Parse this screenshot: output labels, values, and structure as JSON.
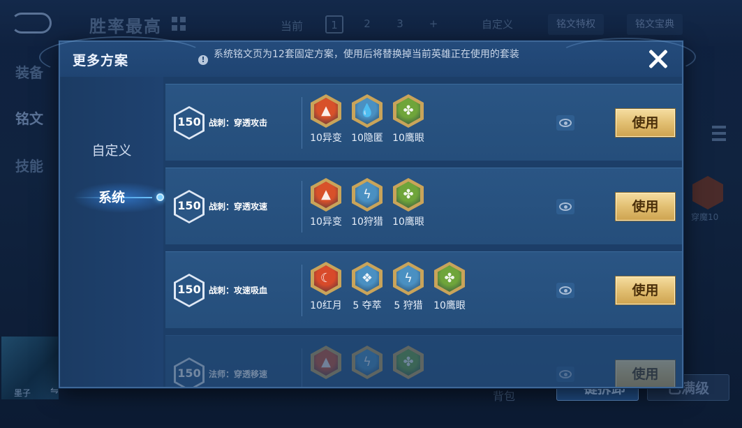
{
  "background": {
    "title": "胜率最高",
    "current_label": "当前",
    "pages": [
      "1",
      "2",
      "3",
      "+"
    ],
    "custom_label": "自定义",
    "buttons": [
      "铭文特权",
      "铭文宝典"
    ],
    "side_tabs": [
      "装备",
      "铭文",
      "技能"
    ],
    "rune_label": "穿魔10",
    "hero_name": "墨子",
    "swap_icon": "⇋",
    "bag_label": "背包",
    "bottom_buttons": [
      "一键拆卸",
      "已满级"
    ]
  },
  "modal": {
    "title": "更多方案",
    "notice": "系统铭文页为12套固定方案，使用后将替换掉当前英雄正在使用的套装",
    "tabs": [
      {
        "label": "自定义",
        "active": false
      },
      {
        "label": "系统",
        "active": true
      }
    ],
    "use_label": "使用",
    "schemes": [
      {
        "level": "150",
        "name": "战刺：穿透攻击",
        "runes": [
          {
            "label": "10异变",
            "icon": "red-arrow-icon",
            "color": "#d8512a"
          },
          {
            "label": "10隐匿",
            "icon": "blue-drop-icon",
            "color": "#4a90c2"
          },
          {
            "label": "10鹰眼",
            "icon": "green-clover-icon",
            "color": "#6fa53a"
          }
        ]
      },
      {
        "level": "150",
        "name": "战刺：穿透攻速",
        "runes": [
          {
            "label": "10异变",
            "icon": "red-arrow-icon",
            "color": "#d8512a"
          },
          {
            "label": "10狩猎",
            "icon": "blue-lightning-icon",
            "color": "#4a90c2"
          },
          {
            "label": "10鹰眼",
            "icon": "green-clover-icon",
            "color": "#6fa53a"
          }
        ]
      },
      {
        "level": "150",
        "name": "战刺：攻速吸血",
        "runes": [
          {
            "label": "10红月",
            "icon": "red-moon-icon",
            "color": "#d84a2a"
          },
          {
            "label": "5 夺萃",
            "icon": "blue-knot-icon",
            "color": "#4a90c2"
          },
          {
            "label": "5 狩猎",
            "icon": "blue-lightning-icon",
            "color": "#4a90c2"
          },
          {
            "label": "10鹰眼",
            "icon": "green-clover-icon",
            "color": "#6fa53a"
          }
        ]
      },
      {
        "level": "150",
        "name": "法师：穿透移速",
        "runes": [
          {
            "label": "",
            "icon": "red-arrow-icon",
            "color": "#d8512a"
          },
          {
            "label": "",
            "icon": "blue-lightning-icon",
            "color": "#4a90c2"
          },
          {
            "label": "",
            "icon": "green-clover-icon",
            "color": "#6fa53a"
          }
        ]
      }
    ]
  }
}
